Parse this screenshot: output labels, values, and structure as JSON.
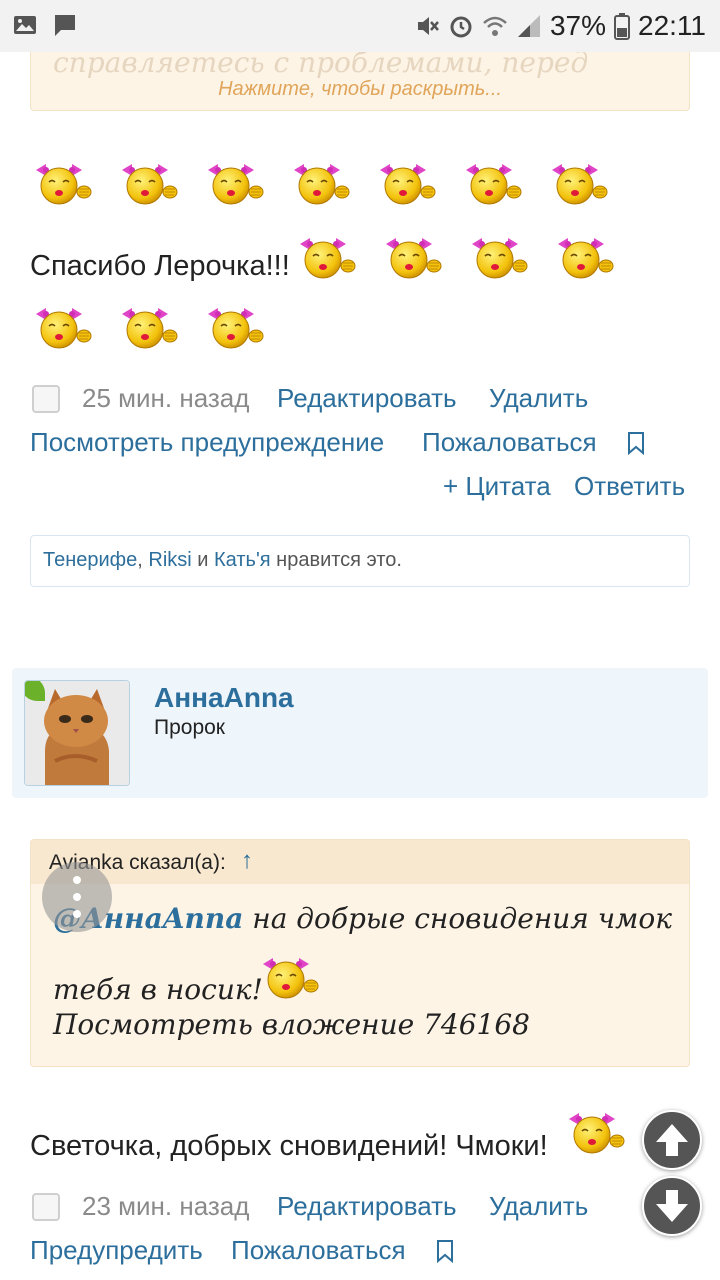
{
  "status_bar": {
    "battery": "37%",
    "time": "22:11",
    "icons": [
      "gallery-icon",
      "message-icon",
      "mute-icon",
      "alarm-icon",
      "wifi-icon",
      "signal-icon",
      "battery-icon"
    ]
  },
  "collapsed_quote": {
    "faded_text": "справляетесь с проблемами, перед",
    "expand_label": "Нажмите, чтобы раскрыть..."
  },
  "post1": {
    "text": "Спасибо Лерочка!!!",
    "time": "25 мин. назад",
    "edit": "Редактировать",
    "delete": "Удалить",
    "view_warning": "Посмотреть предупреждение",
    "report": "Пожаловаться",
    "quote": "+ Цитата",
    "reply": "Ответить",
    "likes": {
      "users": [
        "Тенерифе",
        "Riksi",
        "Кать'я"
      ],
      "sep1": ", ",
      "and": " и ",
      "suffix": " нравится это."
    }
  },
  "post2": {
    "username": "АннаAnna",
    "user_title": "Пророк",
    "quote": {
      "author": "Avianka сказал(а):",
      "arrow": "↑",
      "mention": "@АннаAnna",
      "line1_rest": " на добрые сновидения чмок",
      "line2": "тебя в носик!",
      "attachment": "Посмотреть вложение 746168"
    },
    "text": "Светочка, добрых сновидений! Чмоки!",
    "time": "23 мин. назад",
    "edit": "Редактировать",
    "delete": "Удалить",
    "warn": "Предупредить",
    "report": "Пожаловаться"
  },
  "colors": {
    "link": "#2d6f9c",
    "quote_bg": "#fdf4e6",
    "user_block_bg": "#eef5fb"
  }
}
